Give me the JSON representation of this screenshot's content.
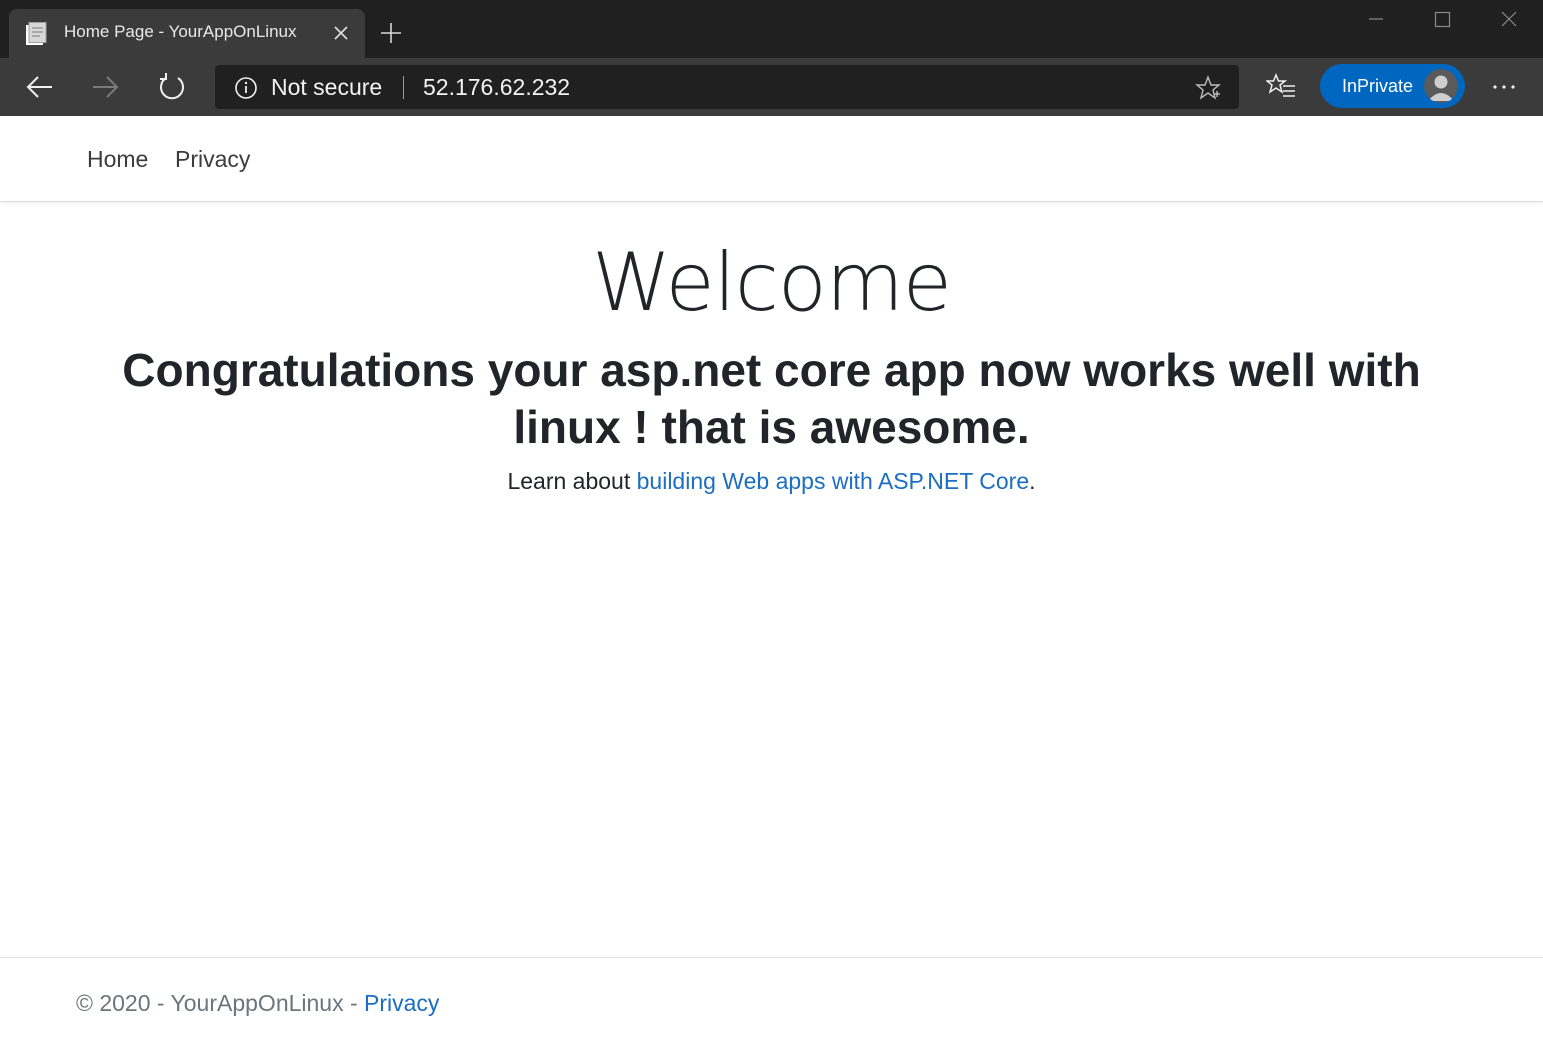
{
  "browser": {
    "tab_title": "Home Page - YourAppOnLinux",
    "address_security": "Not secure",
    "url": "52.176.62.232",
    "profile_label": "InPrivate",
    "colors": {
      "titlebar": "#202020",
      "toolbar": "#3b3b3b",
      "inprivate": "#0067c0"
    },
    "icons": [
      "page-favicon-icon",
      "close-icon",
      "plus-icon",
      "minimize-icon",
      "maximize-icon",
      "window-close-icon",
      "back-arrow-icon",
      "forward-arrow-icon",
      "reload-icon",
      "info-icon",
      "star-icon",
      "favorites-icon",
      "avatar",
      "more-icon"
    ]
  },
  "site_nav": {
    "items": [
      {
        "label": "Home"
      },
      {
        "label": "Privacy"
      }
    ]
  },
  "main": {
    "heading": "Welcome",
    "subheading": "Congratulations your asp.net core app now works well with linux ! that is awesome.",
    "learn_prefix": "Learn about ",
    "learn_link": "building Web apps with ASP.NET Core",
    "learn_suffix": ".",
    "link_color": "#1b6ec2"
  },
  "footer": {
    "copyright": "© 2020 - YourAppOnLinux - ",
    "privacy_link": "Privacy"
  }
}
